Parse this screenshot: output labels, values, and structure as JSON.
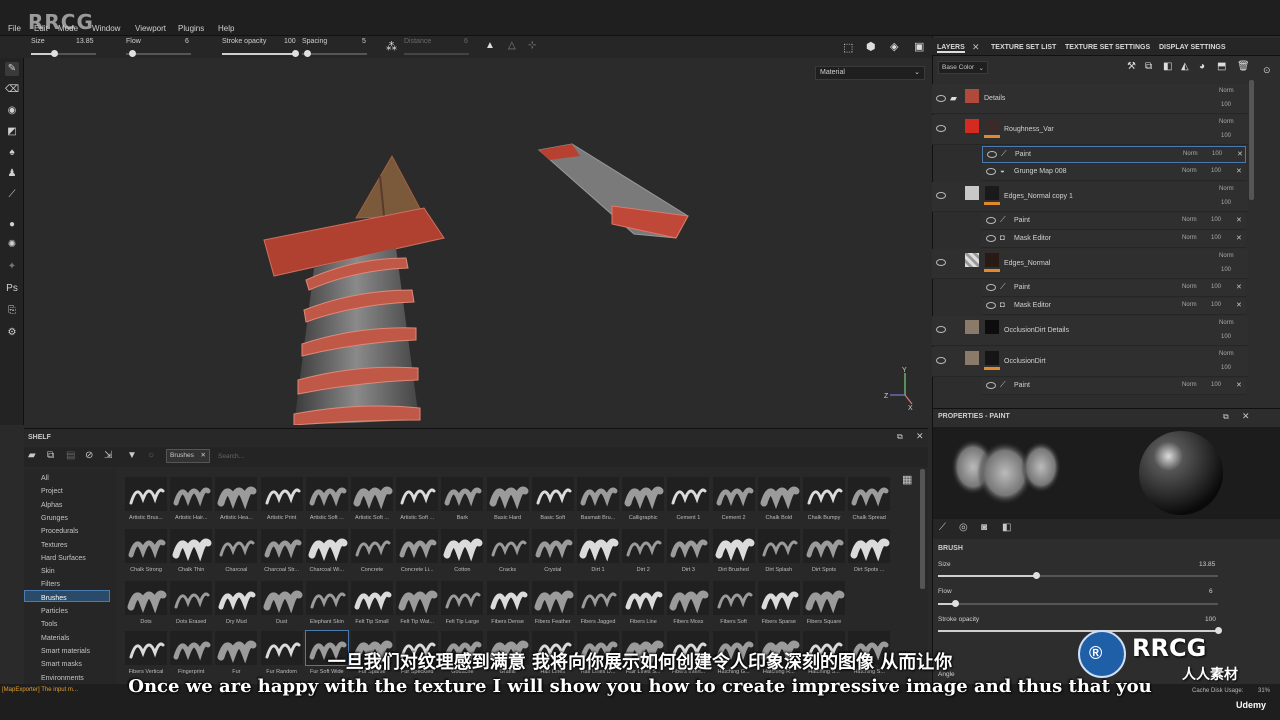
{
  "menu": [
    "File",
    "Edit",
    "Mode",
    "Window",
    "Viewport",
    "Plugins",
    "Help"
  ],
  "watermark": "RRCG",
  "toolbar": {
    "size_label": "Size",
    "size_value": "13.85",
    "flow_label": "Flow",
    "flow_value": "6",
    "opacity_label": "Stroke opacity",
    "opacity_value": "100",
    "spacing_label": "Spacing",
    "spacing_value": "5",
    "distance_label": "Distance",
    "distance_value": "6"
  },
  "viewport": {
    "material_select": "Material"
  },
  "panel_tabs": [
    "LAYERS",
    "TEXTURE SET LIST",
    "TEXTURE SET SETTINGS",
    "DISPLAY SETTINGS"
  ],
  "channel_select": "Base Color",
  "layers": [
    {
      "name": "Details",
      "blend": "Norm",
      "opacity": "100",
      "thumb": "#b04a3a"
    },
    {
      "name": "Roughness_Var",
      "blend": "Norm",
      "opacity": "100",
      "thumb": "#d42a1f"
    },
    {
      "name": "Paint",
      "blend": "Norm",
      "opacity": "100",
      "thumb": ""
    },
    {
      "name": "Grunge Map 008",
      "blend": "Norm",
      "opacity": "100",
      "thumb": ""
    },
    {
      "name": "Edges_Normal copy 1",
      "blend": "Norm",
      "opacity": "100",
      "thumb": "#c8c8c8"
    },
    {
      "name": "Paint",
      "blend": "Norm",
      "opacity": "100",
      "thumb": ""
    },
    {
      "name": "Mask Editor",
      "blend": "Norm",
      "opacity": "100",
      "thumb": ""
    },
    {
      "name": "Edges_Normal",
      "blend": "Norm",
      "opacity": "100",
      "thumb": "#d0d0d0"
    },
    {
      "name": "Paint",
      "blend": "Norm",
      "opacity": "100",
      "thumb": ""
    },
    {
      "name": "Mask Editor",
      "blend": "Norm",
      "opacity": "100",
      "thumb": ""
    },
    {
      "name": "OcclusionDirt Details",
      "blend": "Norm",
      "opacity": "100",
      "thumb": "#8a7a6a"
    },
    {
      "name": "OcclusionDirt",
      "blend": "Norm",
      "opacity": "100",
      "thumb": "#8a7a6a"
    },
    {
      "name": "Paint",
      "blend": "Norm",
      "opacity": "100",
      "thumb": ""
    }
  ],
  "properties": {
    "title": "PROPERTIES - PAINT",
    "section": "BRUSH",
    "size_label": "Size",
    "size_value": "13.85",
    "size_frac": 0.35,
    "flow_label": "Flow",
    "flow_value": "6",
    "flow_frac": 0.06,
    "opacity_label": "Stroke opacity",
    "opacity_value": "100",
    "opacity_frac": 1.0,
    "angle_label": "Angle"
  },
  "shelf": {
    "title": "SHELF",
    "filter_tag": "Brushes",
    "search_placeholder": "Search...",
    "categories": [
      "All",
      "Project",
      "Alphas",
      "Grunges",
      "Procedurals",
      "Textures",
      "Hard Surfaces",
      "Skin",
      "Filters",
      "Brushes",
      "Particles",
      "Tools",
      "Materials",
      "Smart materials",
      "Smart masks",
      "Environments"
    ],
    "selected_category": "Brushes",
    "rows": [
      [
        "Artistic Brus...",
        "Artistic Hair...",
        "Artistic Hea...",
        "Artistic Print",
        "Artistic Soft ...",
        "Artistic Soft ...",
        "Artistic Soft ...",
        "Bark",
        "Basic Hard",
        "Basic Soft",
        "Basmati Bru...",
        "Calligraphic",
        "Cement 1",
        "Cement 2",
        "Chalk Bold",
        "Chalk Bumpy",
        "Chalk Spread"
      ],
      [
        "Chalk Strong",
        "Chalk Thin",
        "Charcoal",
        "Charcoal Str...",
        "Charcoal Wi...",
        "Concrete",
        "Concrete Li...",
        "Cotton",
        "Cracks",
        "Crystal",
        "Dirt 1",
        "Dirt 2",
        "Dirt 3",
        "Dirt Brushed",
        "Dirt Splash",
        "Dirt Spots",
        "Dirt Spots ..."
      ],
      [
        "Dots",
        "Dots Erased",
        "Dry Mud",
        "Dust",
        "Elephant Skin",
        "Felt Tip Small",
        "Felt Tip Wat...",
        "Felt Tip Large",
        "Fibers Dense",
        "Fibers Feather",
        "Fibers Jagged",
        "Fibers Line",
        "Fibers Moss",
        "Fibers Soft",
        "Fibers Sparse",
        "Fibers Square",
        ""
      ],
      [
        "Fibers Vertical",
        "Fingerprint",
        "Fur",
        "Fur Random",
        "Fur Soft Wide",
        "Fur Sparse",
        "Fur Speckled",
        "Gouache",
        "Graffiti",
        "Hair Lines",
        "Hair Lines D...",
        "Hair Lines S...",
        "Fibers Interl...",
        "Hatching G...",
        "Hatching R...",
        "Hatching S...",
        "Hatching S..."
      ]
    ]
  },
  "status": {
    "left": "[MapExporter] The input m...",
    "right": "Cache Disk Usage:",
    "percent": "31%"
  },
  "subtitles": {
    "cn": "一旦我们对纹理感到满意 我将向你展示如何创建令人印象深刻的图像 从而让你",
    "en": "Once we are happy with the texture I will show you how to create impressive image and thus that you"
  },
  "branding": {
    "logo": "RRCG",
    "logo_cn": "人人素材",
    "udemy": "Udemy"
  }
}
